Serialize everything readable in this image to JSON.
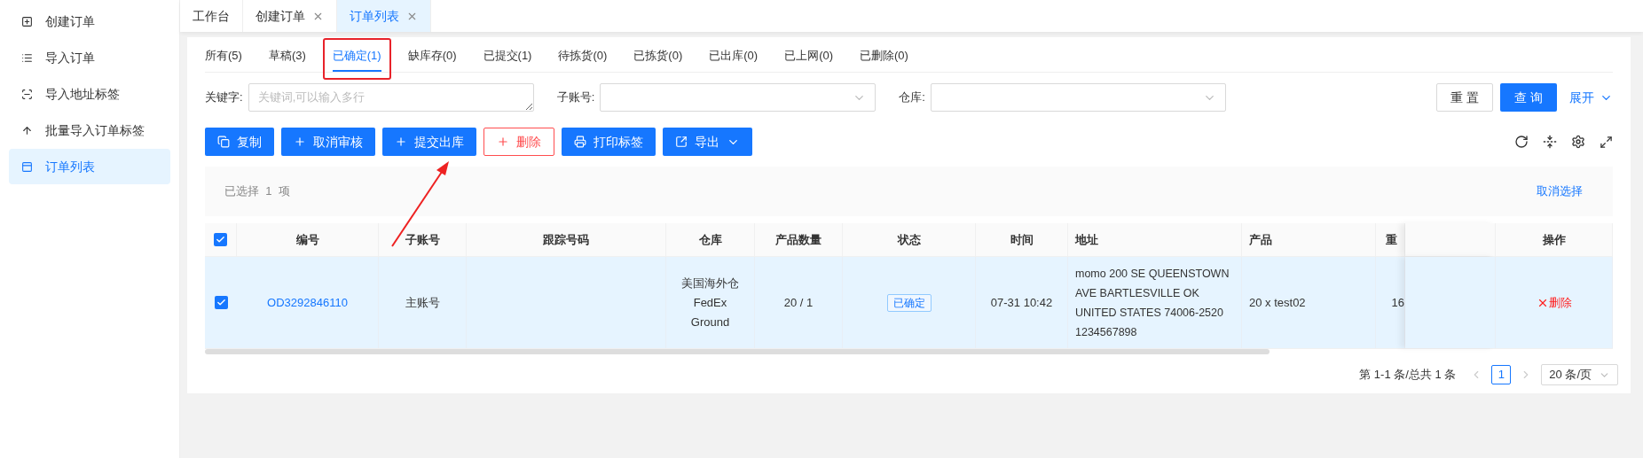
{
  "sidebar": {
    "items": [
      {
        "label": "创建订单",
        "selected": false
      },
      {
        "label": "导入订单",
        "selected": false
      },
      {
        "label": "导入地址标签",
        "selected": false
      },
      {
        "label": "批量导入订单标签",
        "selected": false
      },
      {
        "label": "订单列表",
        "selected": true
      }
    ]
  },
  "page_tabs": [
    {
      "label": "工作台",
      "closable": false,
      "selected": false
    },
    {
      "label": "创建订单",
      "closable": true,
      "selected": false
    },
    {
      "label": "订单列表",
      "closable": true,
      "selected": true
    }
  ],
  "status_tabs": [
    {
      "label": "所有(5)",
      "selected": false
    },
    {
      "label": "草稿(3)",
      "selected": false
    },
    {
      "label": "已确定(1)",
      "selected": true
    },
    {
      "label": "缺库存(0)",
      "selected": false
    },
    {
      "label": "已提交(1)",
      "selected": false
    },
    {
      "label": "待拣货(0)",
      "selected": false
    },
    {
      "label": "已拣货(0)",
      "selected": false
    },
    {
      "label": "已出库(0)",
      "selected": false
    },
    {
      "label": "已上网(0)",
      "selected": false
    },
    {
      "label": "已删除(0)",
      "selected": false
    }
  ],
  "filters": {
    "keyword": {
      "label": "关键字:",
      "placeholder": "关键词,可以输入多行"
    },
    "sub_account": {
      "label": "子账号:"
    },
    "warehouse": {
      "label": "仓库:"
    },
    "reset": "重 置",
    "query": "查 询",
    "expand": "展开"
  },
  "toolbar": [
    {
      "label": "复制",
      "kind": "primary",
      "dropdown": false
    },
    {
      "label": "取消审核",
      "kind": "primary",
      "dropdown": false
    },
    {
      "label": "提交出库",
      "kind": "primary",
      "dropdown": false
    },
    {
      "label": "删除",
      "kind": "danger",
      "dropdown": false
    },
    {
      "label": "打印标签",
      "kind": "primary",
      "dropdown": false
    },
    {
      "label": "导出",
      "kind": "primary",
      "dropdown": true
    }
  ],
  "selection": {
    "text": "已选择  1  项",
    "clear": "取消选择"
  },
  "table": {
    "all_checked": true,
    "columns": [
      "编号",
      "子账号",
      "跟踪号码",
      "仓库",
      "产品数量",
      "状态",
      "时间",
      "地址",
      "产品",
      "重",
      "",
      "操作"
    ],
    "rows": [
      {
        "selected": true,
        "cells": [
          {
            "kind": "link",
            "lines": [
              "OD3292846110"
            ]
          },
          {
            "kind": "text",
            "lines": [
              "主账号"
            ]
          },
          {
            "kind": "empty"
          },
          {
            "kind": "text",
            "lines": [
              "美国海外仓",
              "FedEx",
              "Ground"
            ]
          },
          {
            "kind": "text",
            "lines": [
              "20 / 1"
            ]
          },
          {
            "kind": "tag",
            "lines": [
              "已确定"
            ]
          },
          {
            "kind": "text",
            "lines": [
              "07-31 10:42"
            ]
          },
          {
            "kind": "address",
            "lines": [
              "momo 200 SE QUEENSTOWN",
              "AVE BARTLESVILLE OK",
              "UNITED STATES 74006-2520",
              "1234567898"
            ]
          },
          {
            "kind": "left",
            "lines": [
              "20 x test02"
            ]
          },
          {
            "kind": "text",
            "lines": [
              "16"
            ]
          },
          {
            "kind": "empty"
          },
          {
            "kind": "action",
            "lines": [
              "删除"
            ]
          }
        ]
      }
    ]
  },
  "pagination": {
    "summary": "第 1-1 条/总共 1 条",
    "pages": [
      {
        "label": "1",
        "selected": true
      }
    ],
    "page_size": "20 条/页"
  }
}
